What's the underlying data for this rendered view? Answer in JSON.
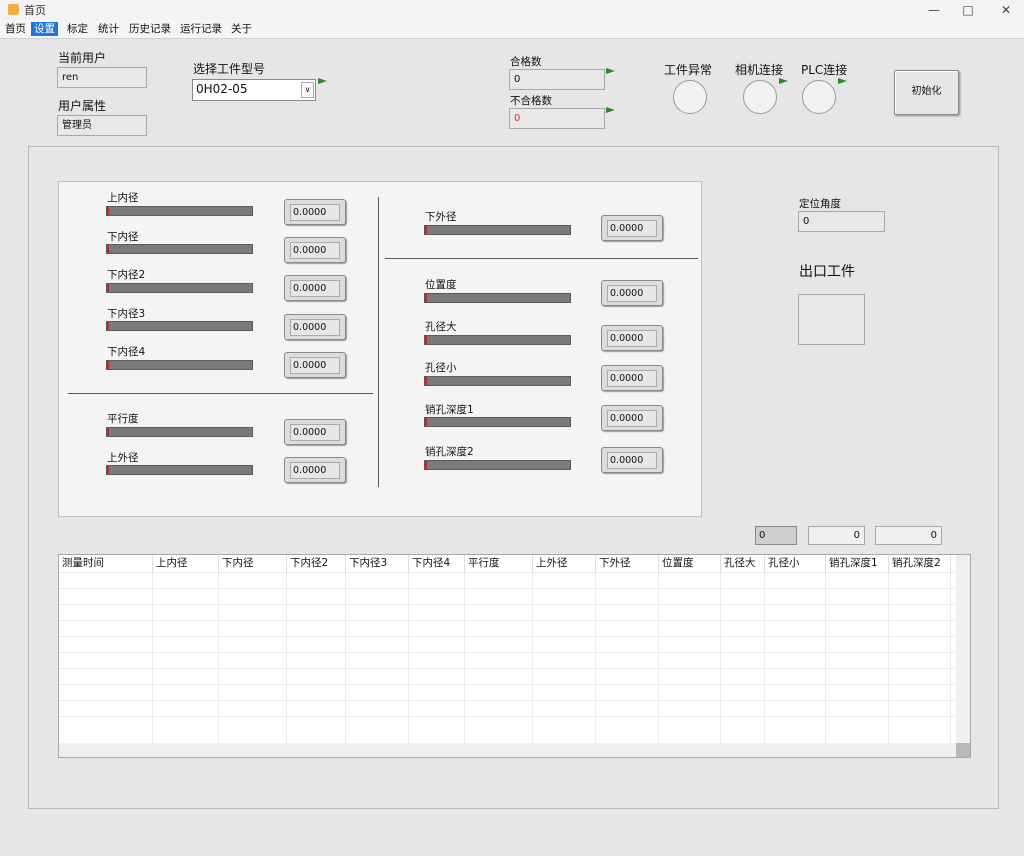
{
  "window": {
    "title": "首页",
    "minimize_icon": "minimize-icon",
    "maximize_icon": "maximize-icon",
    "close_icon": "close-icon"
  },
  "menu": [
    "首页",
    "设置",
    "标定",
    "统计",
    "历史记录",
    "运行记录",
    "关于"
  ],
  "menu_active_index": 1,
  "user": {
    "current_user_label": "当前用户",
    "current_user_value": "ren",
    "attribute_label": "用户属性",
    "attribute_value": "管理员"
  },
  "part_select": {
    "label": "选择工件型号",
    "value": "0H02-05"
  },
  "counts": {
    "pass_label": "合格数",
    "pass_value": "0",
    "fail_label": "不合格数",
    "fail_value": "0"
  },
  "indicators": [
    {
      "label": "工件异常"
    },
    {
      "label": "相机连接"
    },
    {
      "label": "PLC连接"
    }
  ],
  "init_button": "初始化",
  "left_measures_top": [
    {
      "label": "上内径",
      "value": "0.0000"
    },
    {
      "label": "下内径",
      "value": "0.0000"
    },
    {
      "label": "下内径2",
      "value": "0.0000"
    },
    {
      "label": "下内径3",
      "value": "0.0000"
    },
    {
      "label": "下内径4",
      "value": "0.0000"
    }
  ],
  "left_measures_bottom": [
    {
      "label": "平行度",
      "value": "0.0000"
    },
    {
      "label": "上外径",
      "value": "0.0000"
    }
  ],
  "right_measures_top": [
    {
      "label": "下外径",
      "value": "0.0000"
    }
  ],
  "right_measures_bottom": [
    {
      "label": "位置度",
      "value": "0.0000"
    },
    {
      "label": "孔径大",
      "value": "0.0000"
    },
    {
      "label": "孔径小",
      "value": "0.0000"
    },
    {
      "label": "销孔深度1",
      "value": "0.0000"
    },
    {
      "label": "销孔深度2",
      "value": "0.0000"
    }
  ],
  "positioning": {
    "label": "定位角度",
    "value": "0"
  },
  "exit_part": {
    "label": "出口工件"
  },
  "table_counters": [
    "0",
    "0",
    "0"
  ],
  "table": {
    "columns": [
      "测量时间",
      "上内径",
      "下内径",
      "下内径2",
      "下内径3",
      "下内径4",
      "平行度",
      "上外径",
      "下外径",
      "位置度",
      "孔径大",
      "孔径小",
      "销孔深度1",
      "销孔深度2"
    ]
  },
  "colors": {
    "accent": "#1e78d7",
    "flag": "#2a8a2a",
    "bar_marker": "#d21e1e",
    "fail_value": "#e03030"
  }
}
